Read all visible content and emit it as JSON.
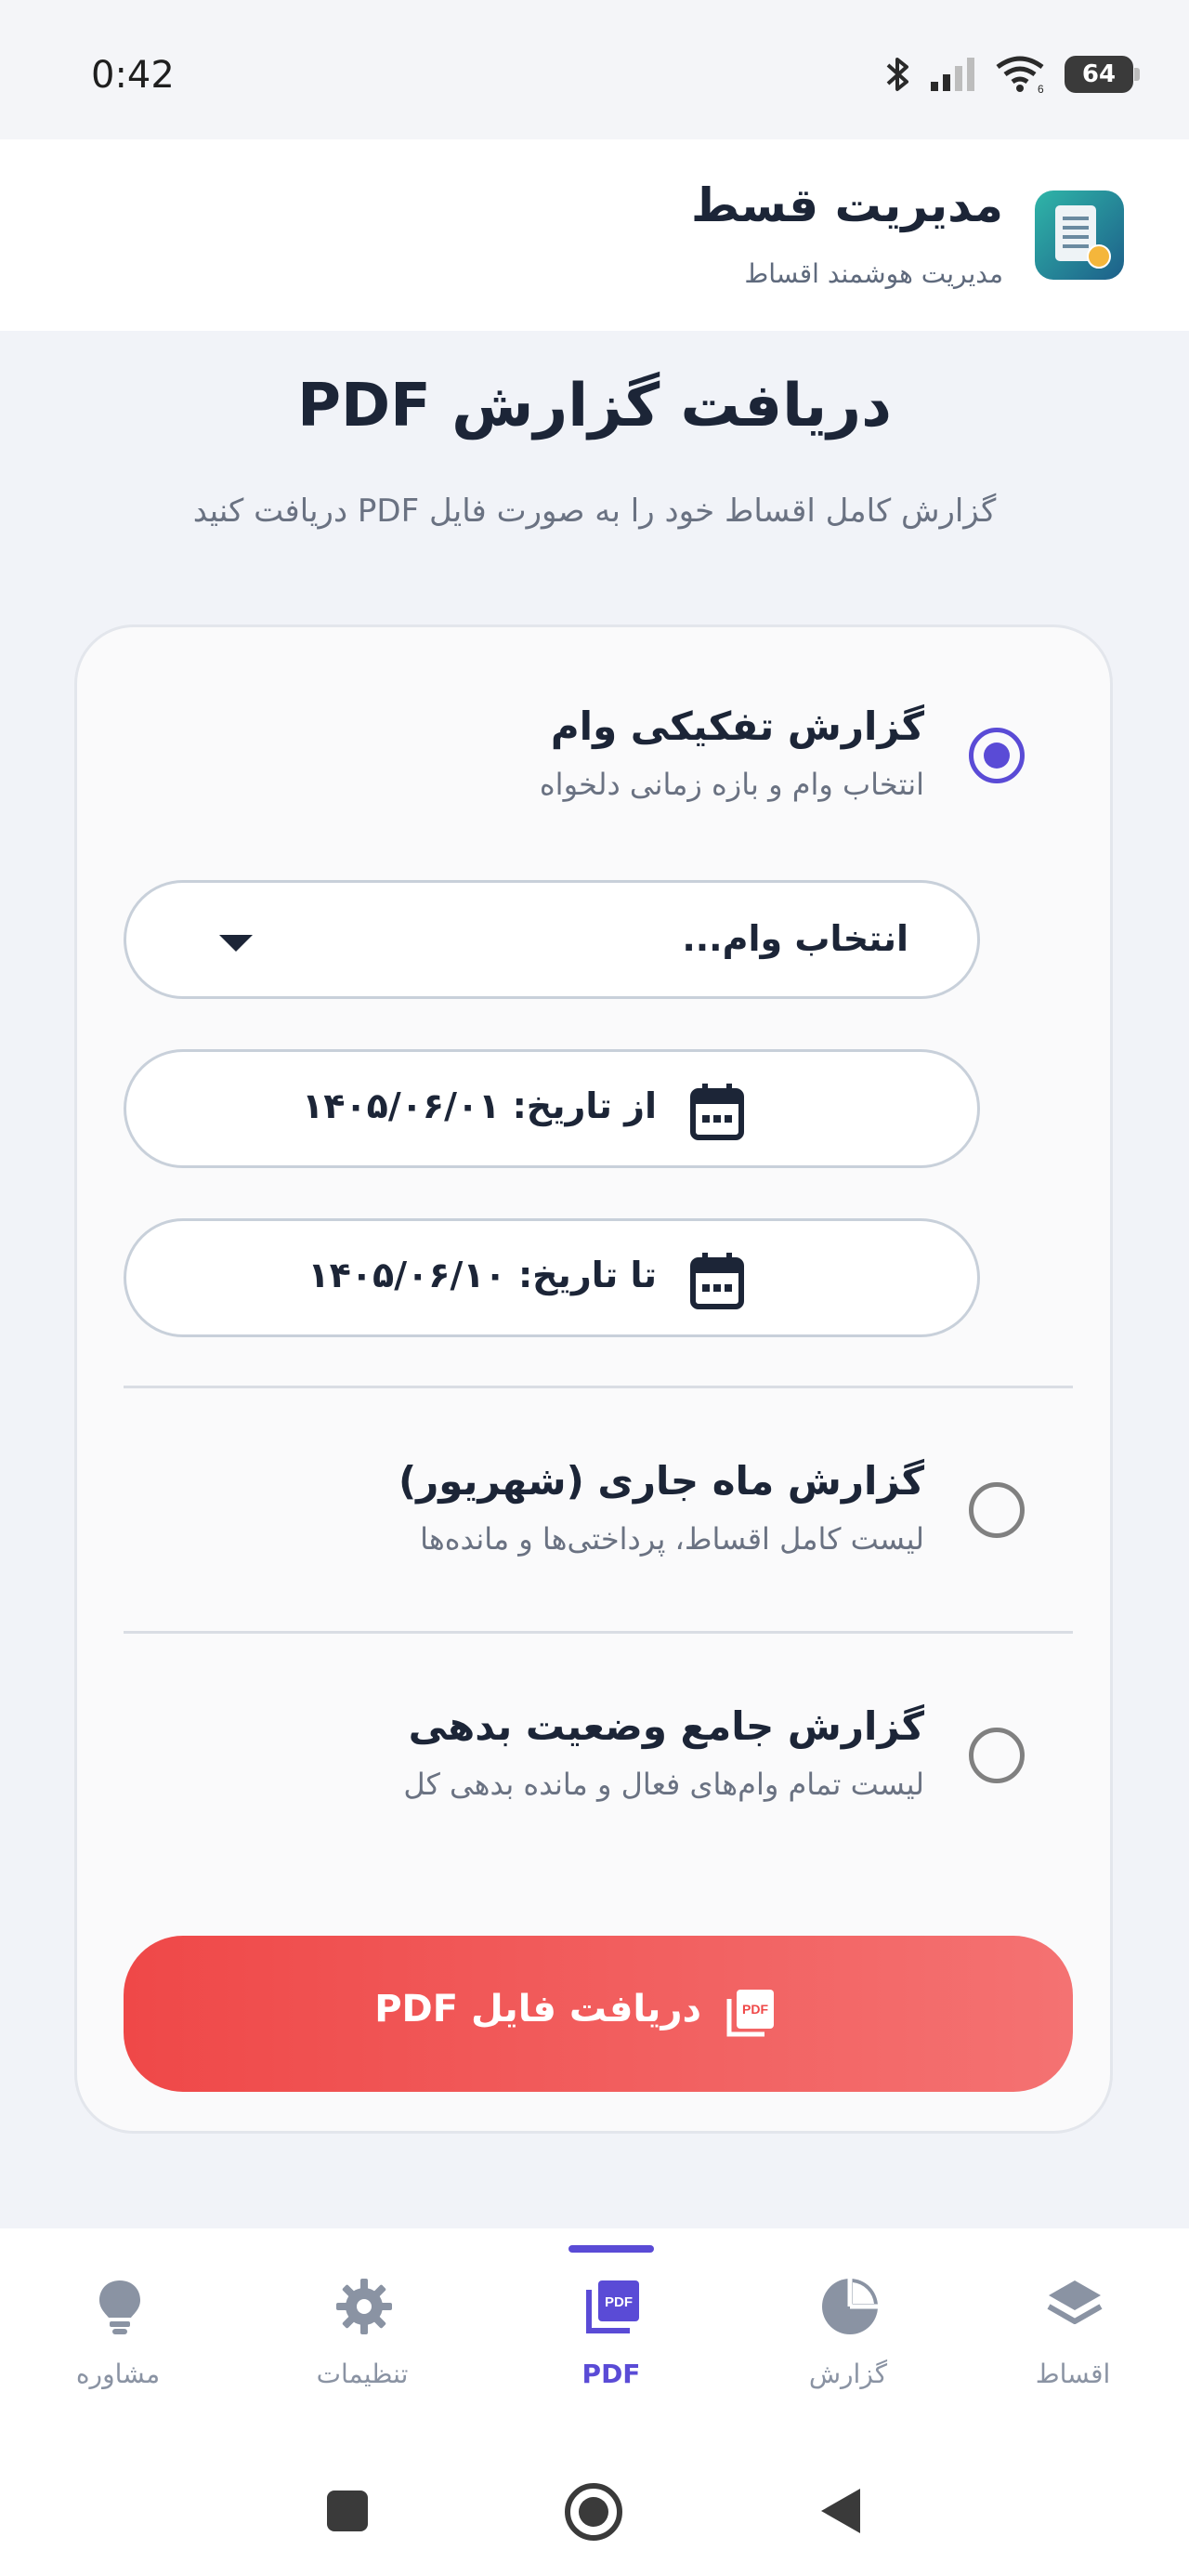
{
  "status_bar": {
    "time": "0:42",
    "battery": "64"
  },
  "header": {
    "app_title": "مدیریت قسط",
    "app_subtitle": "مدیریت هوشمند اقساط"
  },
  "page": {
    "title": "دریافت گزارش PDF",
    "subtitle": "گزارش کامل اقساط خود را به صورت فایل PDF دریافت کنید"
  },
  "report_options": [
    {
      "title": "گزارش تفکیکی وام",
      "description": "انتخاب وام و بازه زمانی دلخواه",
      "selected": true
    },
    {
      "title": "گزارش ماه جاری (شهریور)",
      "description": "لیست کامل اقساط، پرداختی‌ها و مانده‌ها",
      "selected": false
    },
    {
      "title": "گزارش جامع وضعیت بدهی",
      "description": "لیست تمام وام‌های فعال و مانده بدهی کل",
      "selected": false
    }
  ],
  "loan_select": {
    "placeholder": "انتخاب وام..."
  },
  "date_from": {
    "label": "از تاریخ: ۱۴۰۵/۰۶/۰۱"
  },
  "date_to": {
    "label": "تا تاریخ: ۱۴۰۵/۰۶/۱۰"
  },
  "download_button": {
    "label": "دریافت فایل PDF",
    "colors": [
      "#ef4848",
      "#f47272"
    ]
  },
  "bottom_nav": [
    {
      "label": "مشاوره",
      "icon": "lightbulb-icon"
    },
    {
      "label": "تنظیمات",
      "icon": "gear-icon"
    },
    {
      "label": "PDF",
      "icon": "pdf-icon",
      "active": true
    },
    {
      "label": "گزارش",
      "icon": "pie-chart-icon"
    },
    {
      "label": "اقساط",
      "icon": "layers-icon"
    }
  ],
  "colors": {
    "accent": "#5a4bd6",
    "danger": "#ef4848",
    "text": "#1c2537",
    "muted": "#6a7282"
  }
}
